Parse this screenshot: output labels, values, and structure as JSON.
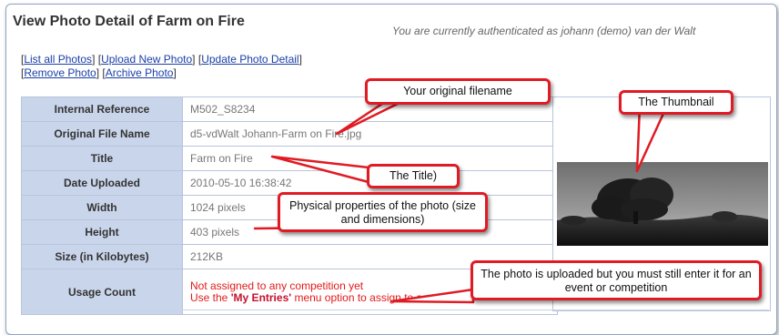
{
  "page": {
    "title": "View Photo Detail of Farm on Fire",
    "auth_text": "You are currently authenticated as johann (demo) van der Walt"
  },
  "links": {
    "list_all": "List all Photos",
    "upload_new": "Upload New Photo",
    "update_detail": "Update Photo Detail",
    "remove": "Remove Photo",
    "archive": "Archive Photo"
  },
  "detail": {
    "internal_reference": {
      "label": "Internal Reference",
      "value": "M502_S8234"
    },
    "original_file_name": {
      "label": "Original File Name",
      "value": "d5-vdWalt Johann-Farm on Fire.jpg"
    },
    "title": {
      "label": "Title",
      "value": "Farm on Fire"
    },
    "date_uploaded": {
      "label": "Date Uploaded",
      "value": "2010-05-10 16:38:42"
    },
    "width": {
      "label": "Width",
      "value": "1024 pixels"
    },
    "height": {
      "label": "Height",
      "value": "403 pixels"
    },
    "size": {
      "label": "Size (in Kilobytes)",
      "value": "212KB"
    },
    "usage_count": {
      "label": "Usage Count",
      "line1": "Not assigned to any competition yet",
      "line2_prefix": "Use the ",
      "line2_bold": "'My Entries'",
      "line2_suffix": " menu option to assign to a"
    }
  },
  "callouts": {
    "filename": "Your original filename",
    "thumbnail": "The Thumbnail",
    "title": "The Title)",
    "physical": "Physical properties of the photo (size and dimensions)",
    "usage": "The photo is uploaded but you must still enter it for an event or competition"
  },
  "colors": {
    "callout_border": "#e01b24",
    "label_cell": "#c9d5ea",
    "link": "#1a3fa8",
    "usage_text": "#e21a1a"
  }
}
